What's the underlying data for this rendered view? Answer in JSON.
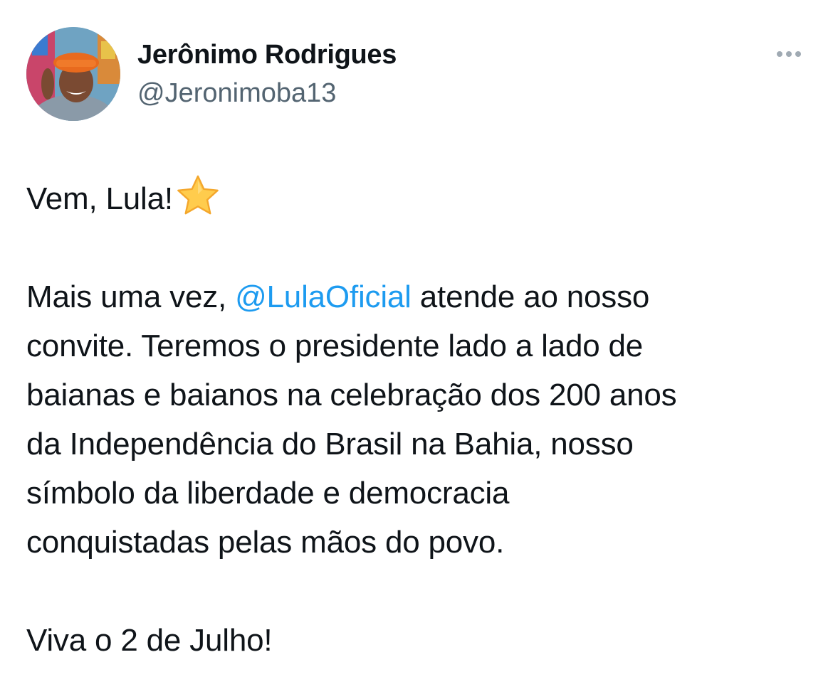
{
  "author": {
    "name": "Jerônimo Rodrigues",
    "handle": "@Jeronimoba13"
  },
  "more_menu": {
    "icon": "ellipsis-icon"
  },
  "tweet": {
    "intro": "Vem, Lula!",
    "intro_emoji": "star-icon",
    "p2": {
      "before_mention": "Mais uma vez, ",
      "mention": "@LulaOficial",
      "after_mention": " atende ao nosso",
      "lines": [
        "convite. Teremos o presidente lado a lado de",
        "baianas e baianos na celebração dos 200 anos",
        "da Independência do Brasil na Bahia, nosso",
        "símbolo da liberdade e democracia",
        "conquistadas pelas mãos do povo."
      ]
    },
    "closing": "Viva o 2 de Julho!"
  },
  "colors": {
    "mention": "#1d9bf0",
    "text": "#0f1419",
    "secondary": "#536471",
    "star": "#ffcc4d"
  }
}
